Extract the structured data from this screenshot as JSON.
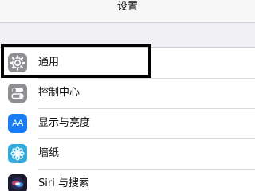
{
  "nav": {
    "title": "设置"
  },
  "items": [
    {
      "label": "通用",
      "icon": "gear-icon",
      "color": "#8e8e93"
    },
    {
      "label": "控制中心",
      "icon": "toggles-icon",
      "color": "#8e8e93"
    },
    {
      "label": "显示与亮度",
      "icon": "text-size-icon",
      "icon_text": "AA",
      "color": "#1a7cf5"
    },
    {
      "label": "墙纸",
      "icon": "flower-icon",
      "color": "#33aadc"
    },
    {
      "label": "Siri 与搜索",
      "icon": "siri-icon",
      "color": "#1a1a2e"
    }
  ],
  "highlight_color": "#000000"
}
